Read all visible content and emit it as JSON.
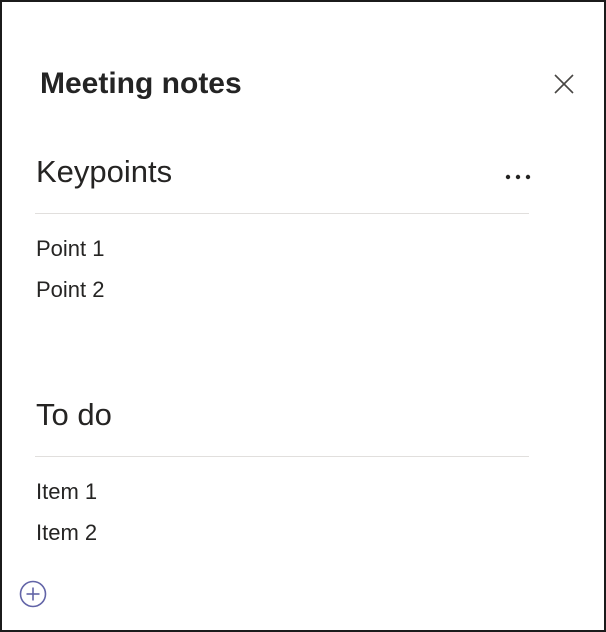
{
  "panel": {
    "title": "Meeting notes",
    "close_icon": "close-icon",
    "add_icon": "add-circle-icon"
  },
  "sections": [
    {
      "title": "Keypoints",
      "more_icon": "more-horizontal-icon",
      "items": [
        "Point 1",
        "Point 2"
      ]
    },
    {
      "title": "To do",
      "items": [
        "Item 1",
        "Item 2"
      ]
    }
  ],
  "colors": {
    "text": "#252423",
    "divider": "#e1dfdd",
    "accent": "#6264a7",
    "border": "#1b1b1b"
  }
}
